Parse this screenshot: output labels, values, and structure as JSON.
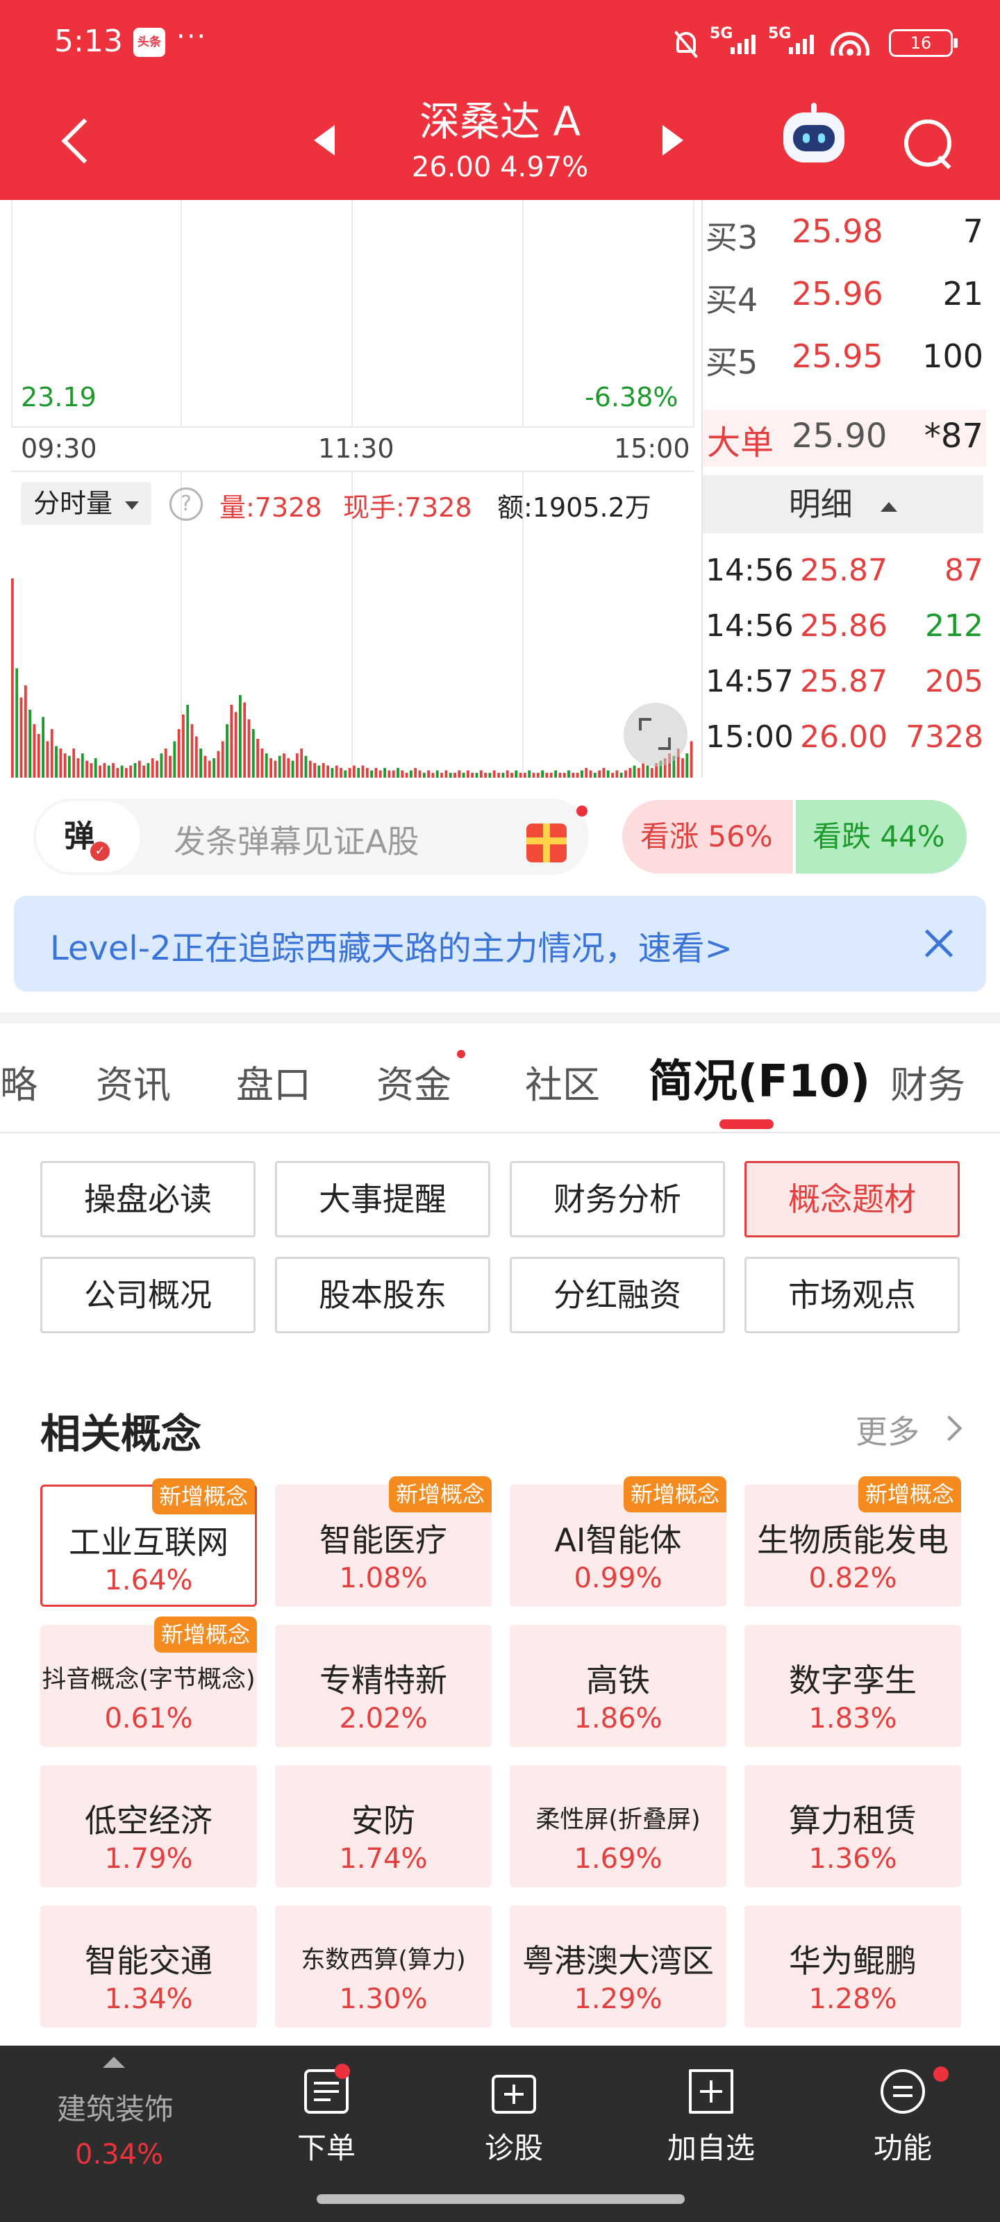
{
  "status_bar": {
    "time": "5:13",
    "badge": "头条",
    "dots": "···",
    "network": "5G",
    "network2": "5G",
    "battery": "16"
  },
  "header": {
    "stock_name": "深桑达 A",
    "price_line": "26.00 4.97%"
  },
  "colors": {
    "brand_red": "#ee323d",
    "up_red": "#e43f3f",
    "down_green": "#1c9a2c",
    "banner_blue": "#3a74d8"
  },
  "chart": {
    "low_price": "23.19",
    "low_pct": "-6.38%",
    "times": [
      "09:30",
      "11:30",
      "15:00"
    ],
    "volume_mode": "分时量",
    "help": "?",
    "volume_stats": {
      "vol": "量:7328",
      "now_hand": "现手:7328",
      "amount": "额:1905.2万"
    },
    "volume_bars": [
      0.82,
      0.45,
      0.33,
      0.38,
      0.28,
      0.22,
      0.18,
      0.25,
      0.15,
      0.2,
      0.13,
      0.12,
      0.1,
      0.09,
      0.12,
      0.08,
      0.1,
      0.07,
      0.06,
      0.08,
      0.05,
      0.06,
      0.05,
      0.06,
      0.04,
      0.05,
      0.04,
      0.05,
      0.06,
      0.07,
      0.05,
      0.06,
      0.08,
      0.07,
      0.1,
      0.12,
      0.09,
      0.15,
      0.2,
      0.26,
      0.3,
      0.22,
      0.17,
      0.12,
      0.09,
      0.07,
      0.08,
      0.11,
      0.15,
      0.22,
      0.3,
      0.27,
      0.34,
      0.31,
      0.24,
      0.2,
      0.16,
      0.12,
      0.1,
      0.08,
      0.07,
      0.09,
      0.1,
      0.08,
      0.07,
      0.1,
      0.12,
      0.09,
      0.07,
      0.06,
      0.05,
      0.06,
      0.05,
      0.04,
      0.05,
      0.04,
      0.03,
      0.04,
      0.05,
      0.04,
      0.05,
      0.04,
      0.03,
      0.04,
      0.03,
      0.04,
      0.03,
      0.03,
      0.04,
      0.03,
      0.02,
      0.03,
      0.04,
      0.03,
      0.02,
      0.03,
      0.02,
      0.03,
      0.02,
      0.03,
      0.02,
      0.02,
      0.03,
      0.02,
      0.03,
      0.02,
      0.02,
      0.03,
      0.02,
      0.02,
      0.03,
      0.02,
      0.02,
      0.03,
      0.02,
      0.03,
      0.02,
      0.02,
      0.03,
      0.02,
      0.02,
      0.03,
      0.02,
      0.02,
      0.03,
      0.02,
      0.02,
      0.03,
      0.02,
      0.02,
      0.03,
      0.04,
      0.03,
      0.02,
      0.03,
      0.04,
      0.03,
      0.02,
      0.03,
      0.02,
      0.03,
      0.04,
      0.05,
      0.04,
      0.06,
      0.05,
      0.04,
      0.06,
      0.07,
      0.08,
      0.1,
      0.09,
      0.12,
      0.08,
      0.1,
      0.15
    ]
  },
  "order_book": {
    "buys": [
      {
        "label": "买3",
        "price": "25.98",
        "vol": "7"
      },
      {
        "label": "买4",
        "price": "25.96",
        "vol": "21"
      },
      {
        "label": "买5",
        "price": "25.95",
        "vol": "100"
      }
    ],
    "big_order": {
      "label": "大单",
      "price": "25.90",
      "vol": "*87"
    },
    "detail_label": "明细",
    "trades": [
      {
        "time": "14:56",
        "price": "25.87",
        "vol": "87",
        "dir": "up"
      },
      {
        "time": "14:56",
        "price": "25.86",
        "vol": "212",
        "dir": "down"
      },
      {
        "time": "14:57",
        "price": "25.87",
        "vol": "205",
        "dir": "up"
      },
      {
        "time": "15:00",
        "price": "26.00",
        "vol": "7328",
        "dir": "up"
      }
    ]
  },
  "danmaku": {
    "icon_text": "弹",
    "placeholder": "发条弹幕见证A股",
    "bull": "看涨 56%",
    "bear": "看跌 44%"
  },
  "banner": {
    "text": "Level-2正在追踪西藏天路的主力情况，速看>"
  },
  "tabs": [
    "略",
    "资讯",
    "盘口",
    "资金",
    "社区",
    "简况(F10)",
    "财务"
  ],
  "f10_buttons": [
    [
      "操盘必读",
      "大事提醒",
      "财务分析",
      "概念题材"
    ],
    [
      "公司概况",
      "股本股东",
      "分红融资",
      "市场观点"
    ]
  ],
  "concepts": {
    "title": "相关概念",
    "more": "更多",
    "new_tag": "新增概念",
    "items": [
      {
        "name": "工业互联网",
        "pct": "1.64%",
        "new": true
      },
      {
        "name": "智能医疗",
        "pct": "1.08%",
        "new": true
      },
      {
        "name": "AI智能体",
        "pct": "0.99%",
        "new": true
      },
      {
        "name": "生物质能发电",
        "pct": "0.82%",
        "new": true
      },
      {
        "name": "抖音概念(字节概念)",
        "pct": "0.61%",
        "new": true
      },
      {
        "name": "专精特新",
        "pct": "2.02%",
        "new": false
      },
      {
        "name": "高铁",
        "pct": "1.86%",
        "new": false
      },
      {
        "name": "数字孪生",
        "pct": "1.83%",
        "new": false
      },
      {
        "name": "低空经济",
        "pct": "1.79%",
        "new": false
      },
      {
        "name": "安防",
        "pct": "1.74%",
        "new": false
      },
      {
        "name": "柔性屏(折叠屏)",
        "pct": "1.69%",
        "new": false
      },
      {
        "name": "算力租赁",
        "pct": "1.36%",
        "new": false
      },
      {
        "name": "智能交通",
        "pct": "1.34%",
        "new": false
      },
      {
        "name": "东数西算(算力)",
        "pct": "1.30%",
        "new": false
      },
      {
        "name": "粤港澳大湾区",
        "pct": "1.29%",
        "new": false
      },
      {
        "name": "华为鲲鹏",
        "pct": "1.28%",
        "new": false
      }
    ]
  },
  "bottom_bar": {
    "sector": "建筑装饰",
    "sector_pct": "0.34%",
    "items": [
      "下单",
      "诊股",
      "加自选",
      "功能"
    ]
  }
}
